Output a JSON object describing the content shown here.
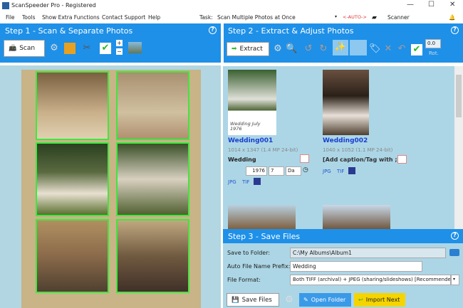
{
  "window": {
    "title": "ScanSpeeder Pro - Registered",
    "minimize": "—",
    "maximize": "☐",
    "close": "✕"
  },
  "menu": {
    "items": [
      "File",
      "Tools",
      "Show Extra Functions",
      "Contact Support",
      "Help"
    ],
    "task_label": "Task:",
    "task_value": "Scan Multiple Photos at Once",
    "auto": "<-AUTO->",
    "scanner": "Scanner"
  },
  "step1": {
    "title": "Step 1 - Scan & Separate Photos",
    "help": "?",
    "scan_label": "Scan"
  },
  "step2": {
    "title": "Step 2 - Extract & Adjust Photos",
    "help": "?",
    "extract_label": "Extract",
    "rot_value": "0.0",
    "rot_label": "Rot.",
    "photos": [
      {
        "name": "Wedding001",
        "dims": "1014 x 1347 (1.4 MP 24-bit)",
        "caption": "Wedding",
        "handwriting": "Wedding July 1976",
        "year": "1976",
        "month": "7",
        "day": "Da",
        "jpg": "JPG",
        "tif": "TIF"
      },
      {
        "name": "Wedding002",
        "dims": "1040 x 1052 (1.1 MP 24-bit)",
        "caption": "[Add caption/Tag with ;]",
        "jpg": "JPG",
        "tif": "TIF"
      }
    ]
  },
  "step3": {
    "title": "Step 3 - Save Files",
    "help": "?",
    "save_folder_label": "Save to Folder:",
    "save_folder": "C:\\My Albums\\Album1",
    "prefix_label": "Auto File Name Prefix:",
    "prefix": "Wedding",
    "format_label": "File Format:",
    "format": "Both TIFF (archival) + JPEG (sharing/slideshows) [Recommended]",
    "save_btn": "Save Files",
    "open_folder": "Open Folder",
    "import_next": "Import Next"
  }
}
